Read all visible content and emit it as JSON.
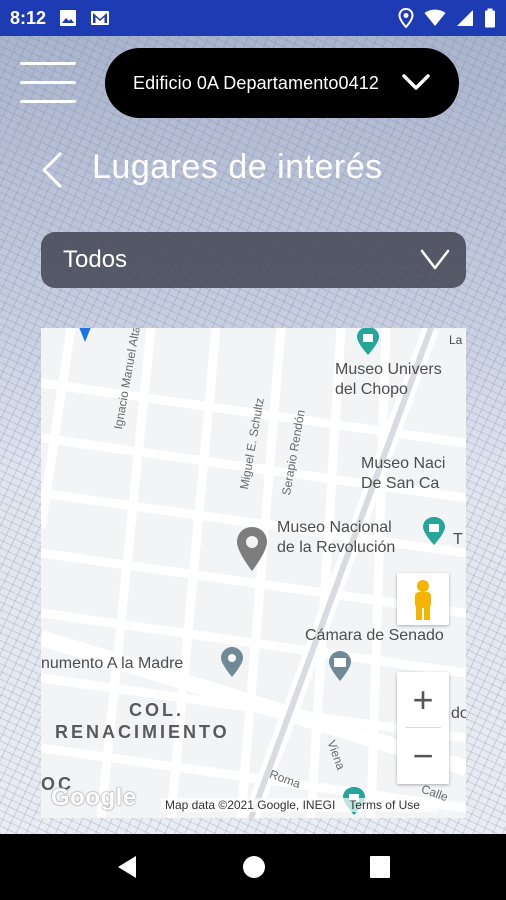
{
  "status_bar": {
    "time": "8:12",
    "icons": [
      "image-icon",
      "gmail-icon",
      "location-icon",
      "wifi-icon",
      "signal-icon",
      "battery-icon"
    ]
  },
  "header": {
    "building_selector": "Edificio 0A Departamento0412",
    "title": "Lugares de interés"
  },
  "filter": {
    "selected": "Todos"
  },
  "map": {
    "pois": [
      "Museo Universitario del Chopo",
      "Museo Nacional de San Carlos",
      "Museo Nacional de la Revolución",
      "Cámara de Senadores",
      "Monumento A la Madre"
    ],
    "poi_labels": {
      "chopo_1": "Museo Univers",
      "chopo_2": "del Chopo",
      "sancarlos_1": "Museo Naci",
      "sancarlos_2": "De San Ca",
      "revolucion_1": "Museo Nacional",
      "revolucion_2": "de la Revolución",
      "senado": "Cámara de Senado",
      "madre": "numento A la Madre",
      "edge_la": "La",
      "edge_t": "T",
      "edge_do": "do",
      "edge_calle": "Calle",
      "edge_oc": "OC"
    },
    "streets": {
      "altamirano": "Ignacio Manuel Altamirano",
      "schultz": "Miguel E. Schultz",
      "rendon": "Serapio Rendón",
      "roma": "Roma",
      "viena": "Viena"
    },
    "district_1": "COL.",
    "district_2": "RENACIMIENTO",
    "zoom_in": "+",
    "zoom_out": "−",
    "google": "Google",
    "map_data": "Map data ©2021 Google, INEGI",
    "terms": "Terms of Use"
  },
  "colors": {
    "status_bar": "#1d3bb3",
    "poi_teal": "#26a69a",
    "pin_gray": "#7d7d7d"
  }
}
